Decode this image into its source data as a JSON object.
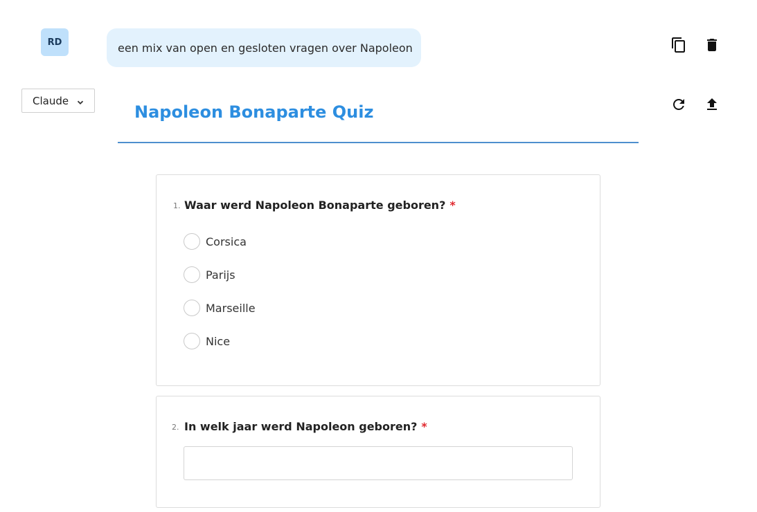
{
  "user_message": {
    "avatar_initials": "RD",
    "text": "een mix van open en gesloten vragen over Napoleon"
  },
  "message_actions": {
    "copy_icon": "copy-icon",
    "delete_icon": "trash-icon"
  },
  "response_actions": {
    "regenerate_icon": "refresh-icon",
    "export_icon": "upload-icon"
  },
  "model_select": {
    "selected": "Claude"
  },
  "quiz": {
    "title": "Napoleon Bonaparte Quiz",
    "questions": [
      {
        "number": "1.",
        "text": "Waar werd Napoleon Bonaparte geboren?",
        "required_mark": "*",
        "type": "multiple-choice",
        "options": [
          "Corsica",
          "Parijs",
          "Marseille",
          "Nice"
        ]
      },
      {
        "number": "2.",
        "text": "In welk jaar werd Napoleon geboren?",
        "required_mark": "*",
        "type": "open",
        "answer": ""
      }
    ]
  },
  "colors": {
    "accent": "#2d8ee0",
    "avatar_bg": "#bfe0fb",
    "bubble_bg": "#e3f2fd",
    "required": "#e0282e"
  }
}
